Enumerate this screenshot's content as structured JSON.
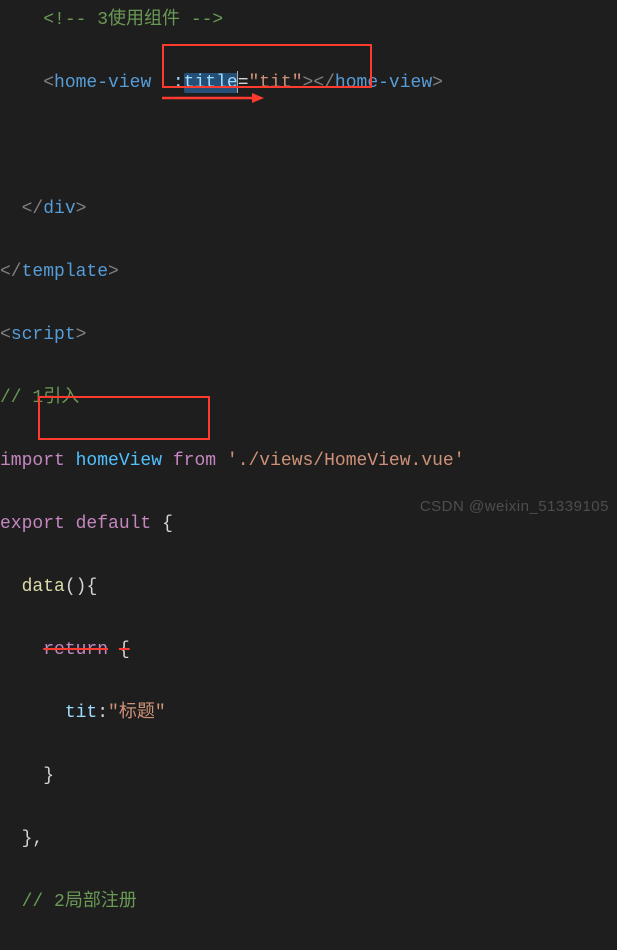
{
  "code": {
    "comment1": "<!-- 3使用组件 -->",
    "homeview_open": "home-view",
    "attr_prefix": ":",
    "attr_name": "title",
    "attr_eq": "=",
    "attr_value": "\"tit\"",
    "homeview_close": "home-view",
    "div_close": "div",
    "template_close": "template",
    "script_open": "script",
    "comment2": "// 1引入",
    "import_kw": "import",
    "import_ident": "homeView",
    "from_kw": "from",
    "import_path": "'./views/HomeView.vue'",
    "export_kw": "export",
    "default_kw": "default",
    "brace_open": "{",
    "data_func": "data",
    "paren": "()",
    "brace_open2": "{",
    "return_kw": "return",
    "brace_open3": "{",
    "prop_name": "tit",
    "colon": ":",
    "prop_value": "\"标题\"",
    "brace_close3": "}",
    "brace_close2_comma": "},",
    "comment3": "// 2局部注册"
  },
  "watermark": "CSDN @weixin_51339105"
}
